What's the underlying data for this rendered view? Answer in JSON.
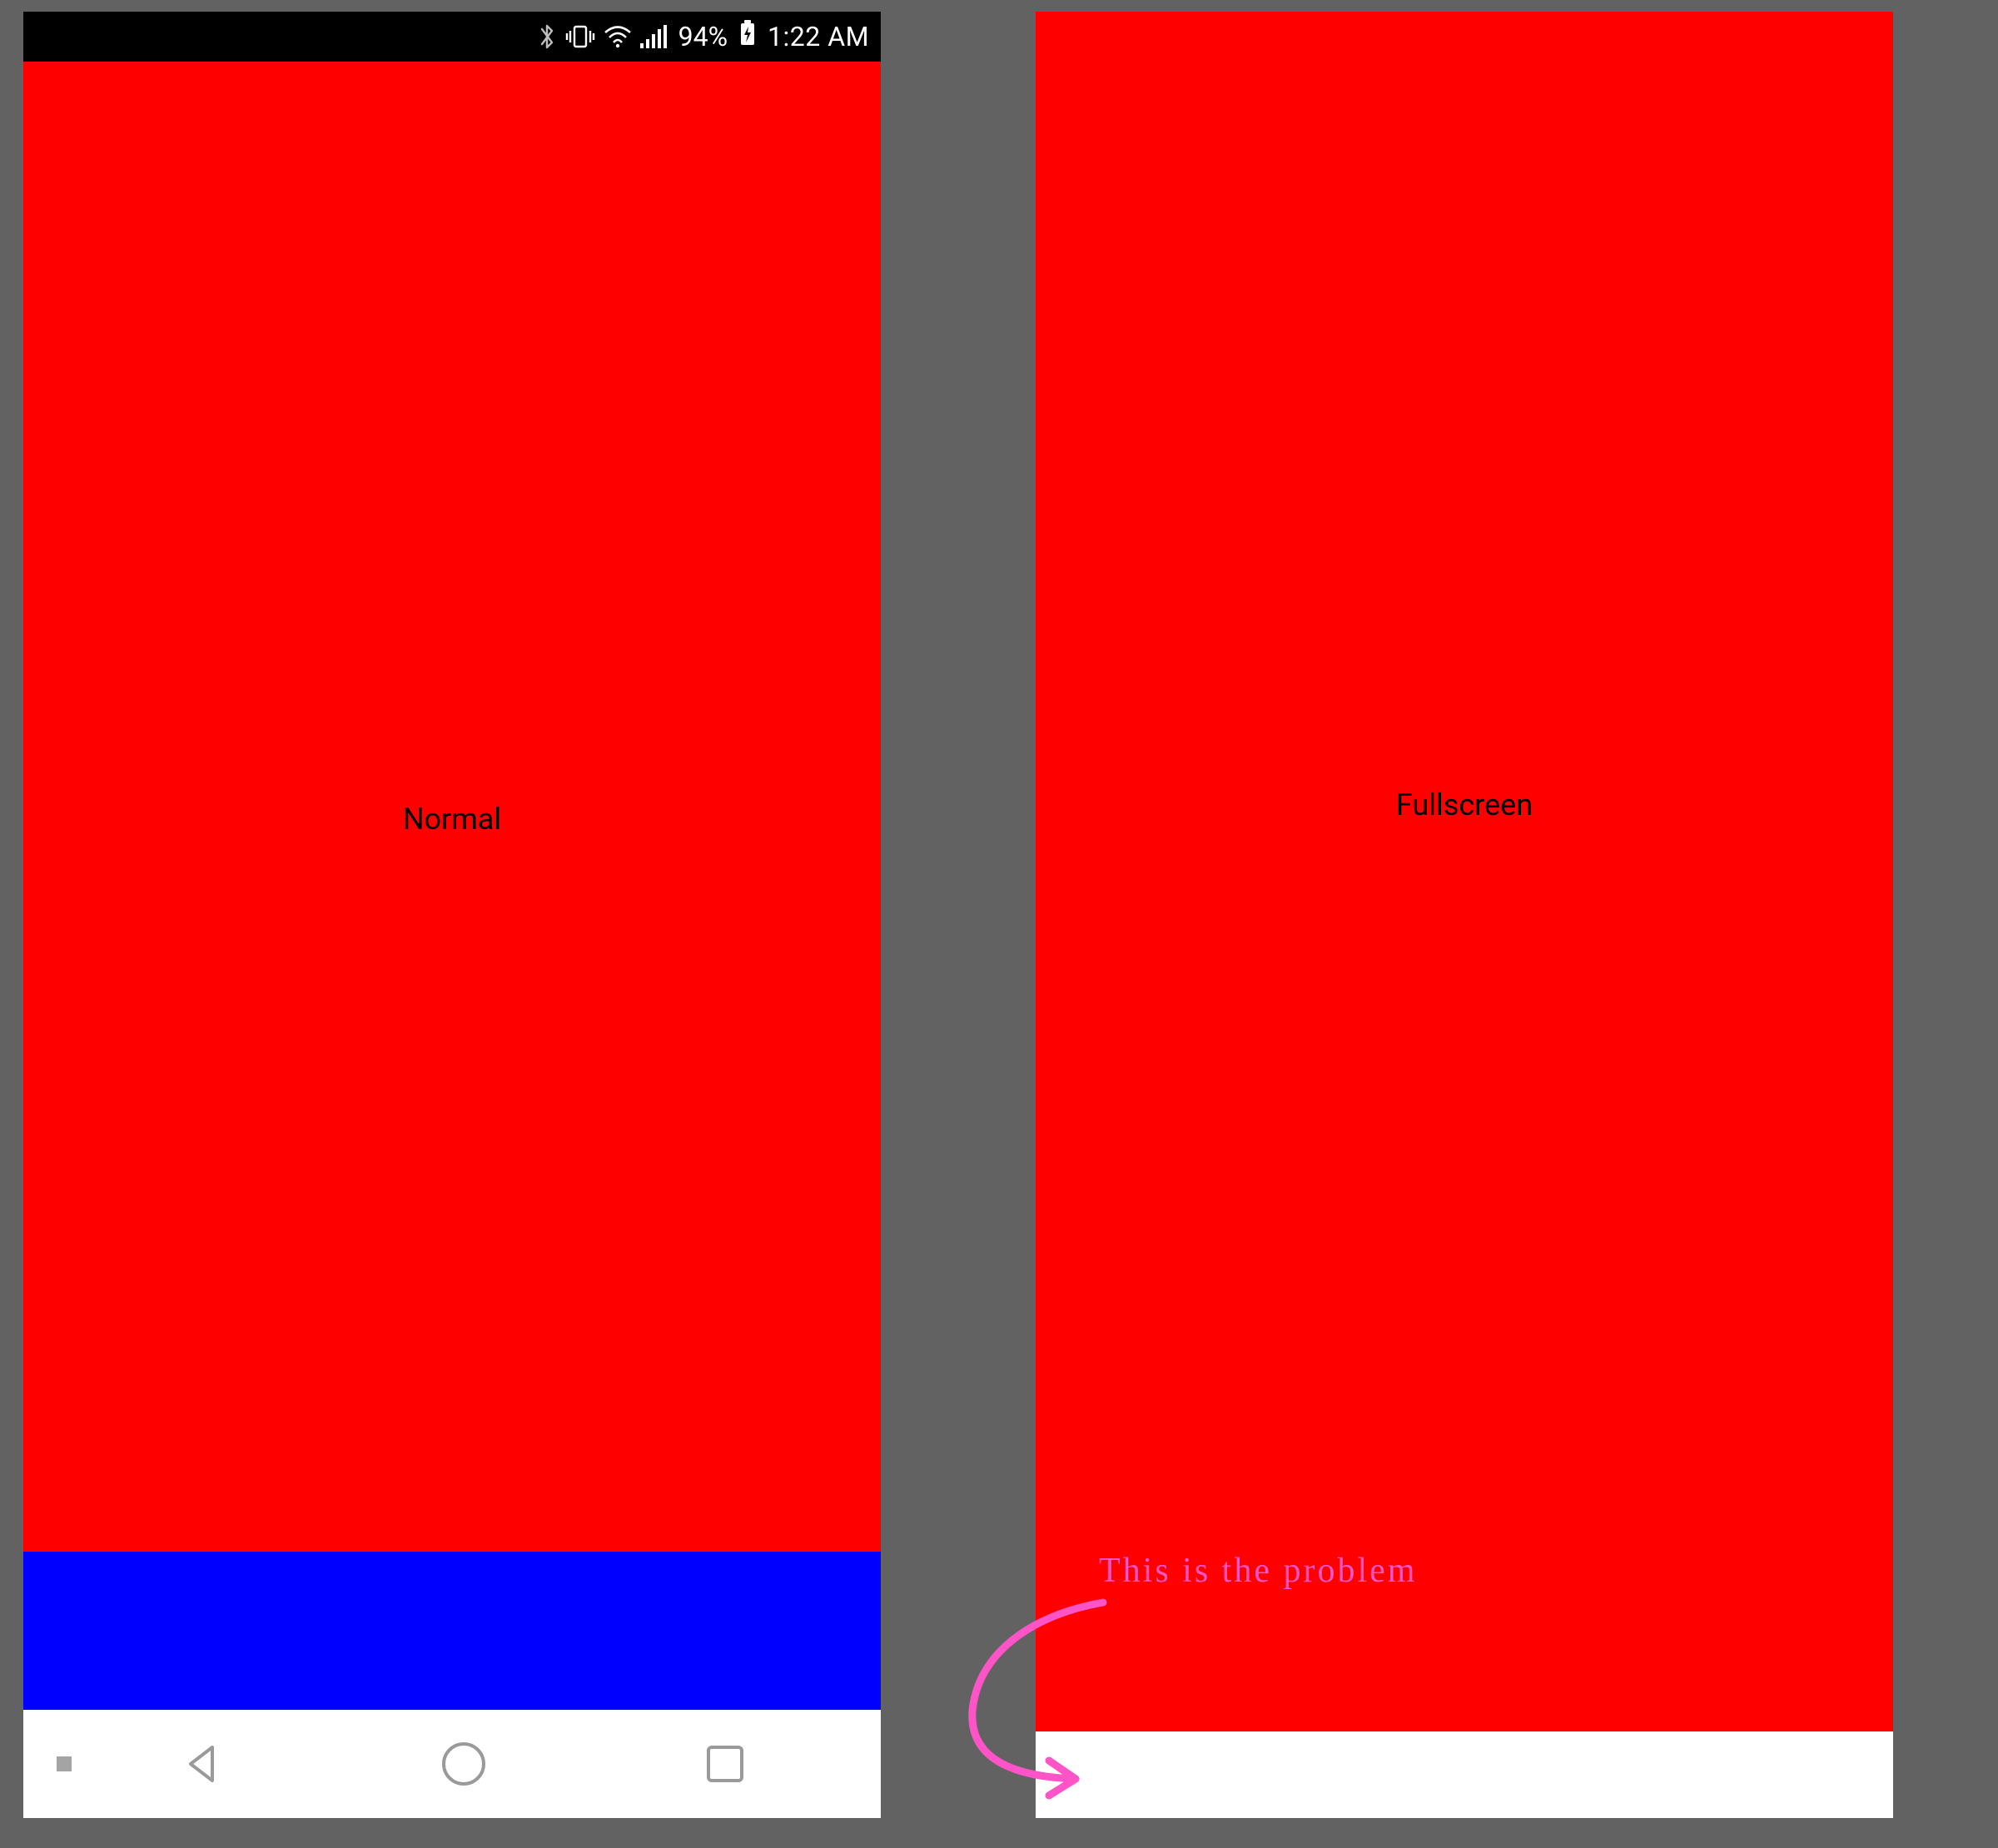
{
  "status_bar": {
    "battery_percent": "94%",
    "time": "1:22 AM"
  },
  "left": {
    "label": "Normal"
  },
  "right": {
    "label": "Fullscreen"
  },
  "annotation": {
    "text": "This is the problem"
  },
  "colors": {
    "bg": "#626262",
    "content": "#ff0000",
    "strip": "#0000ff",
    "annotation": "#ff53c8"
  }
}
